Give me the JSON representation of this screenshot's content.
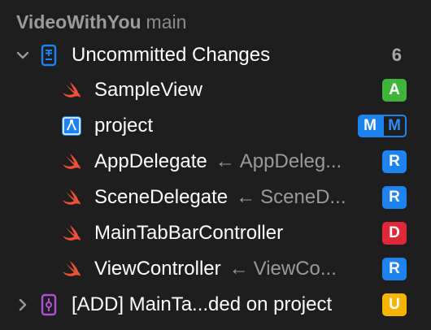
{
  "header": {
    "repo": "VideoWithYou",
    "branch": "main"
  },
  "group_uncommitted": {
    "label": "Uncommitted Changes",
    "count": "6",
    "expanded": true,
    "icon": "document-icon",
    "icon_color": "#1d83f0"
  },
  "files": [
    {
      "name": "SampleView",
      "icon": "swift-icon",
      "status": "A",
      "status_color": "#3fb33a"
    },
    {
      "name": "project",
      "icon": "xcode-project-icon",
      "status_left": "M",
      "status_right": "M",
      "status_color": "#1d83f0"
    },
    {
      "name": "AppDelegate",
      "arrow": "←",
      "original": "AppDeleg...",
      "icon": "swift-icon",
      "status": "R",
      "status_color": "#1d83f0"
    },
    {
      "name": "SceneDelegate",
      "arrow": "←",
      "original": "SceneD...",
      "icon": "swift-icon",
      "status": "R",
      "status_color": "#1d83f0"
    },
    {
      "name": "MainTabBarController",
      "icon": "swift-icon",
      "status": "D",
      "status_color": "#e0283a"
    },
    {
      "name": "ViewController",
      "arrow": "←",
      "original": "ViewCo...",
      "icon": "swift-icon",
      "status": "R",
      "status_color": "#1d83f0"
    }
  ],
  "stash": {
    "label": "[ADD] MainTa...ded on project",
    "icon": "commit-icon",
    "icon_color": "#b04fd6",
    "expanded": false,
    "status": "U",
    "status_color": "#f4b400"
  }
}
